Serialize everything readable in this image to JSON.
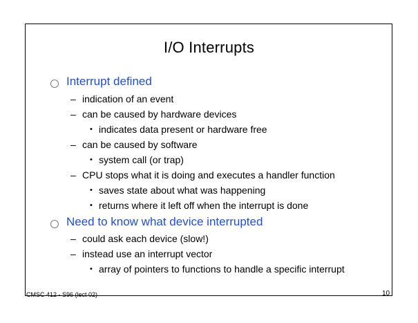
{
  "slide": {
    "title": "I/O Interrupts",
    "sections": [
      {
        "heading": "Interrupt defined",
        "items": [
          {
            "text": "indication of an event",
            "subitems": []
          },
          {
            "text": "can be caused by hardware devices",
            "subitems": [
              "indicates data present or hardware free"
            ]
          },
          {
            "text": "can be caused by software",
            "subitems": [
              "system call (or trap)"
            ]
          },
          {
            "text": "CPU stops what it is doing and executes a handler function",
            "subitems": [
              "saves state about what was happening",
              "returns where it left off when the interrupt is done"
            ]
          }
        ]
      },
      {
        "heading": "Need to know what device interrupted",
        "items": [
          {
            "text": "could ask each device (slow!)",
            "subitems": []
          },
          {
            "text": "instead use an interrupt vector",
            "subitems": [
              "array of pointers to functions to handle a specific interrupt"
            ]
          }
        ]
      }
    ],
    "footer": "CMSC 412 - S96 (lect 02)",
    "page_number": "10",
    "dash_glyph": "–",
    "dot_glyph": "•",
    "heading_color": "#1f4ed8"
  }
}
